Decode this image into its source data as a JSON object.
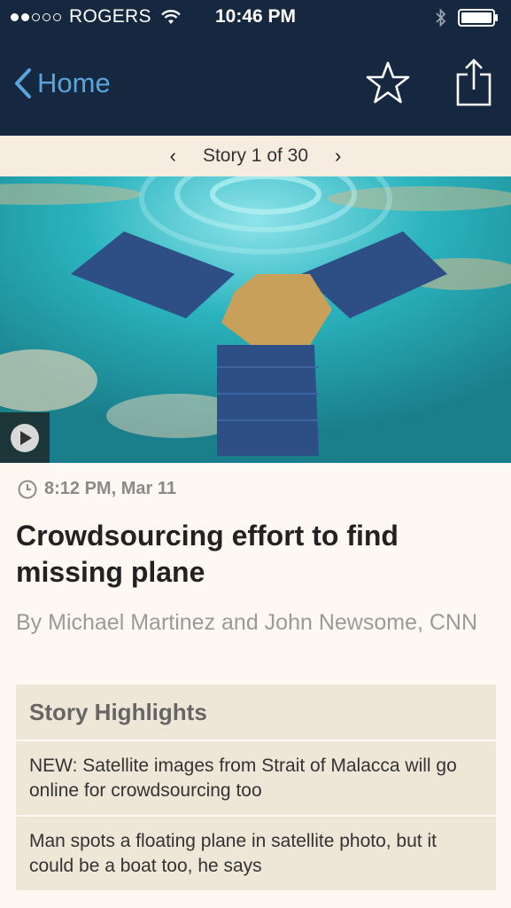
{
  "status_bar": {
    "carrier": "ROGERS",
    "time": "10:46 PM",
    "signal_full": 2,
    "signal_total": 5
  },
  "nav": {
    "back_label": "Home",
    "accent_color": "#5aa4dd",
    "bar_color": "#15283f"
  },
  "story_nav": {
    "label": "Story 1 of 30"
  },
  "article": {
    "timestamp": "8:12 PM, Mar 11",
    "headline": "Crowdsourcing effort to find missing plane",
    "byline": "By Michael Martinez and John Newsome, CNN"
  },
  "highlights": {
    "title": "Story Highlights",
    "items": [
      "NEW: Satellite images from Strait of Malacca will go online for crowdsourcing too",
      "Man spots a floating plane in satellite photo, but it could be a boat too, he says"
    ]
  }
}
